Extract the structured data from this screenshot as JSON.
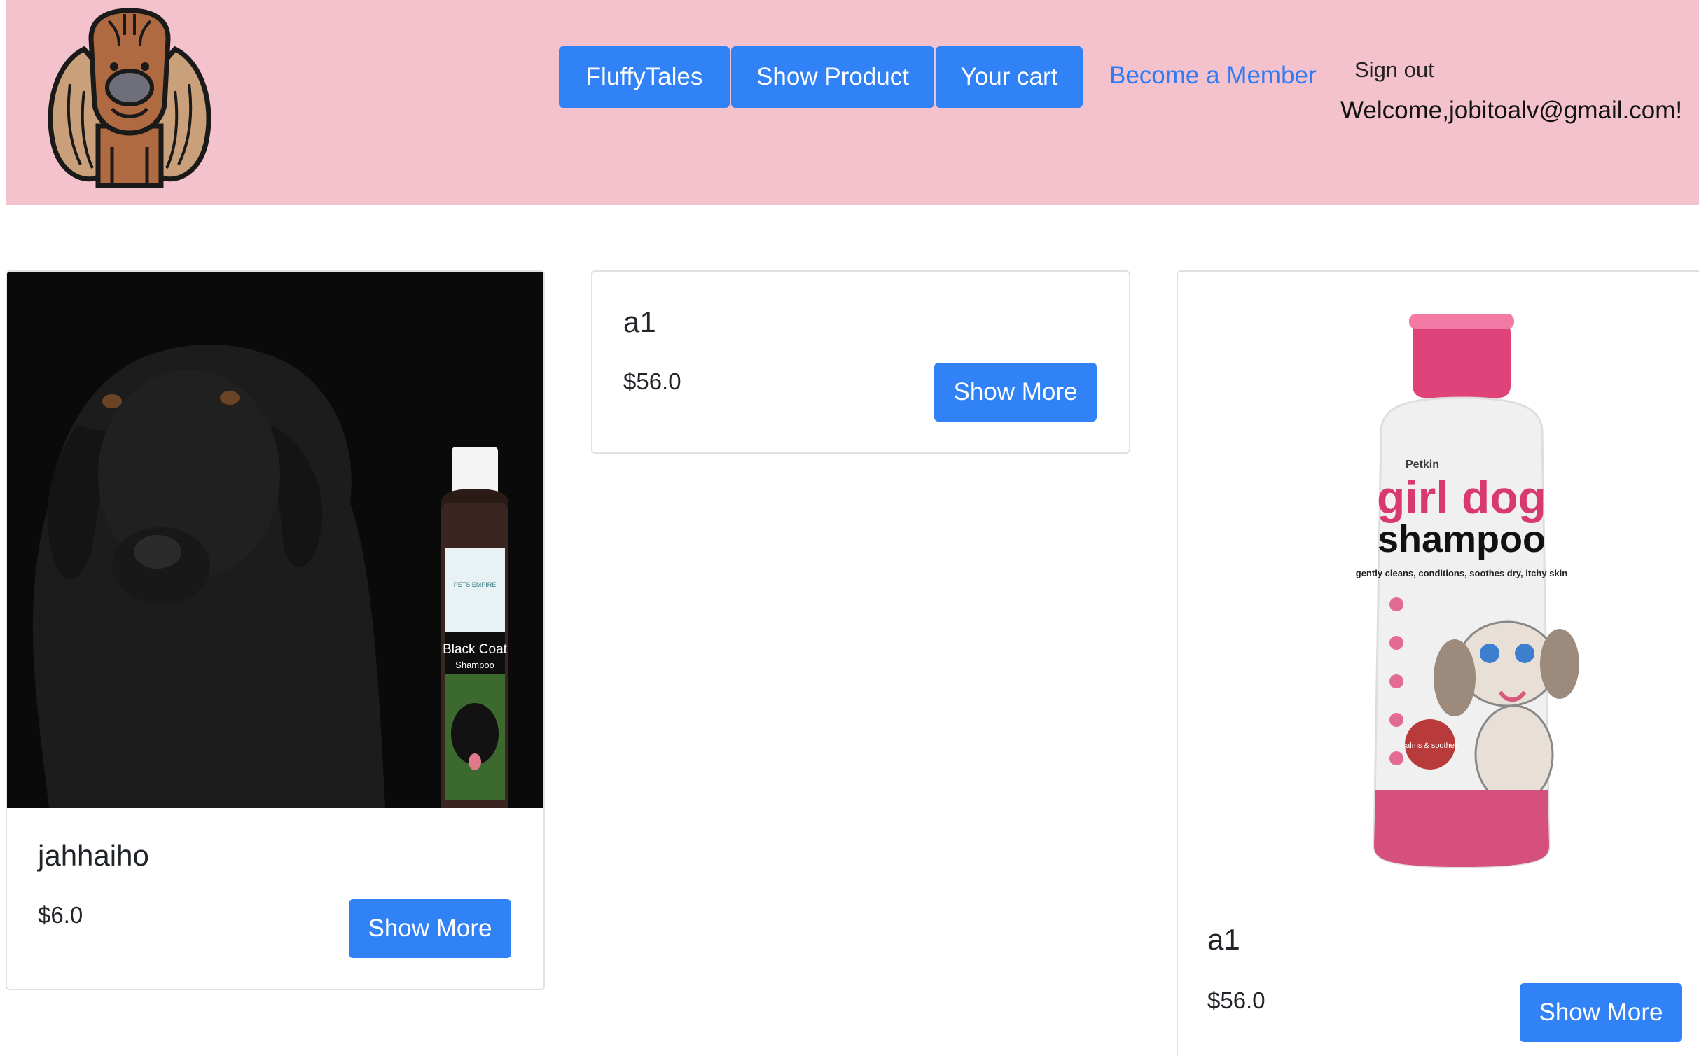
{
  "nav": {
    "buttons": [
      "FluffyTales",
      "Show Product",
      "Your cart"
    ],
    "member_link": "Become a Member",
    "sign_out": "Sign out",
    "welcome": "Welcome,jobitoalv@gmail.com!"
  },
  "products": [
    {
      "title": "jahhaiho",
      "price": "$6.0",
      "button": "Show More",
      "image": {
        "bottle_label_1": "Black Coat",
        "bottle_label_2": "Shampoo",
        "brand": "PETS EMPIRE"
      }
    },
    {
      "title": "a1",
      "price": "$56.0",
      "button": "Show More"
    },
    {
      "title": "a1",
      "price": "$56.0",
      "button": "Show More",
      "image": {
        "brand": "Petkin",
        "line1": "girl dog",
        "line2": "shampoo",
        "tagline": "gently cleans, conditions, soothes dry, itchy skin",
        "badge": "calms & soothes"
      }
    }
  ],
  "colors": {
    "header_bg": "#f4c2cd",
    "primary": "#3082f6",
    "link": "#2f7cf6"
  }
}
